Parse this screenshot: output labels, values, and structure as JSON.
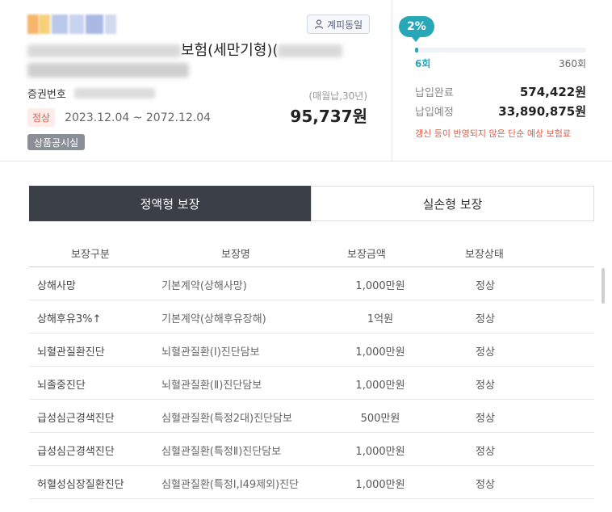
{
  "header": {
    "consent_badge": "계피동일",
    "title_visible": "보험(세만기형)(",
    "policy_label": "증권번호",
    "status": "정상",
    "period": "2023.12.04 ~ 2072.12.04",
    "pay_cycle": "(매월납,30년)",
    "premium": "95,737원",
    "product_button": "상품공시실"
  },
  "payment": {
    "percent_label": "2%",
    "percent_value": 0.017,
    "count_current": "6회",
    "count_total": "360회",
    "paid_label": "납입완료",
    "paid_value": "574,422원",
    "expected_label": "납입예정",
    "expected_value": "33,890,875원",
    "notice": "갱신 등이 반영되지 않은 단순 예상 보험료"
  },
  "tabs": [
    {
      "label": "정액형 보장",
      "active": true
    },
    {
      "label": "실손형 보장",
      "active": false
    }
  ],
  "table": {
    "headers": [
      "보장구분",
      "보장명",
      "보장금액",
      "보장상태"
    ],
    "rows": [
      {
        "category": "상해사망",
        "name": "기본계약(상해사망)",
        "amount": "1,000만원",
        "status": "정상"
      },
      {
        "category": "상해후유3%↑",
        "name": "기본계약(상해후유장해)",
        "amount": "1억원",
        "status": "정상"
      },
      {
        "category": "뇌혈관질환진단",
        "name": "뇌혈관질환(Ⅰ)진단담보",
        "amount": "1,000만원",
        "status": "정상"
      },
      {
        "category": "뇌졸중진단",
        "name": "뇌혈관질환(Ⅱ)진단담보",
        "amount": "1,000만원",
        "status": "정상"
      },
      {
        "category": "급성심근경색진단",
        "name": "심혈관질환(특정2대)진단담보",
        "amount": "500만원",
        "status": "정상"
      },
      {
        "category": "급성심근경색진단",
        "name": "심혈관질환(특정Ⅱ)진단담보",
        "amount": "1,000만원",
        "status": "정상"
      },
      {
        "category": "허혈성심장질환진단",
        "name": "심혈관질환(특정Ⅰ,I49제외)진단",
        "amount": "1,000만원",
        "status": "정상"
      }
    ]
  },
  "colors": {
    "accent": "#27a7b7",
    "status_red": "#e25b45",
    "tab_active": "#3a3f48"
  }
}
